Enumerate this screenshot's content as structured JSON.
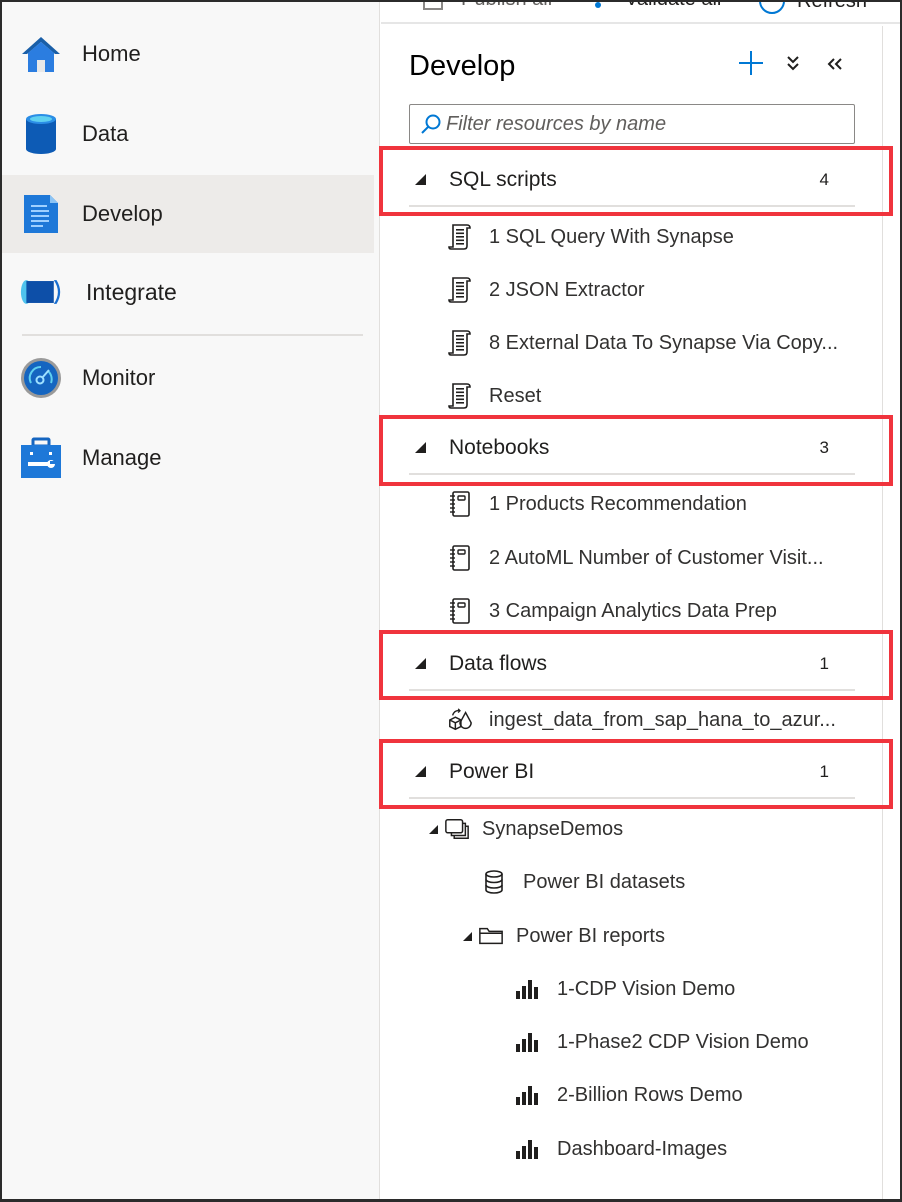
{
  "toolbar": {
    "publish_all": "Publish all",
    "validate_all": "Validate all",
    "refresh": "Refresh"
  },
  "sidebar": {
    "items": [
      {
        "label": "Home",
        "icon": "home-icon",
        "active": false
      },
      {
        "label": "Data",
        "icon": "database-icon",
        "active": false
      },
      {
        "label": "Develop",
        "icon": "document-icon",
        "active": true
      },
      {
        "label": "Integrate",
        "icon": "pipeline-icon",
        "active": false
      },
      {
        "label": "Monitor",
        "icon": "gauge-icon",
        "active": false
      },
      {
        "label": "Manage",
        "icon": "toolbox-icon",
        "active": false
      }
    ]
  },
  "panel": {
    "title": "Develop",
    "add_icon": "plus-icon",
    "collapse_all_icon": "chevron-double-down-icon",
    "hide_panel_icon": "chevron-double-left-icon",
    "search": {
      "placeholder": "Filter resources by name",
      "value": ""
    },
    "sections": [
      {
        "title": "SQL scripts",
        "count": "4",
        "highlighted": true,
        "items": [
          "1 SQL Query With Synapse",
          "2 JSON Extractor",
          "8 External Data To Synapse Via Copy...",
          "Reset"
        ],
        "item_icon": "sql-script-icon"
      },
      {
        "title": "Notebooks",
        "count": "3",
        "highlighted": true,
        "items": [
          "1 Products Recommendation",
          "2 AutoML Number of Customer Visit...",
          "3 Campaign Analytics Data Prep"
        ],
        "item_icon": "notebook-icon"
      },
      {
        "title": "Data flows",
        "count": "1",
        "highlighted": true,
        "items": [
          "ingest_data_from_sap_hana_to_azur..."
        ],
        "item_icon": "dataflow-icon"
      },
      {
        "title": "Power BI",
        "count": "1",
        "highlighted": true,
        "workspace": {
          "name": "SynapseDemos",
          "datasets_label": "Power BI datasets",
          "reports_label": "Power BI reports",
          "reports": [
            "1-CDP Vision Demo",
            "1-Phase2 CDP Vision Demo",
            "2-Billion Rows Demo",
            "Dashboard-Images"
          ]
        }
      }
    ]
  },
  "colors": {
    "accent": "#0078d4",
    "highlight_box": "#f0343d",
    "active_nav": "#edebe9"
  }
}
